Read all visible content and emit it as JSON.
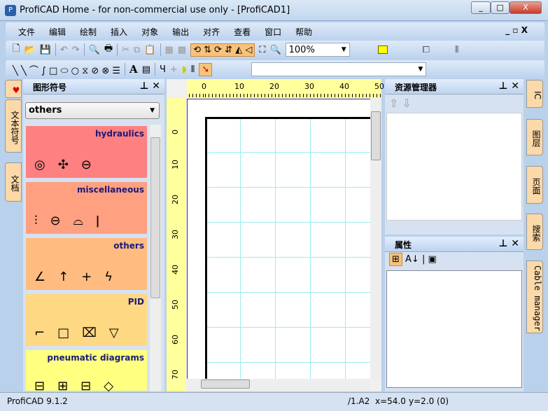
{
  "window": {
    "title": "ProfiCAD Home - for non-commercial use only - [ProfiCAD1]",
    "minimize": "_",
    "maximize": "□",
    "close": "X"
  },
  "menu": [
    "文件",
    "编辑",
    "绘制",
    "插入",
    "对象",
    "输出",
    "对齐",
    "查看",
    "窗口",
    "帮助"
  ],
  "toolbar": {
    "zoom_value": "100%",
    "text_tool": "A",
    "style_combo": ""
  },
  "left_tabs": [
    "文本符号",
    "文档"
  ],
  "symbols_panel": {
    "title": "图形符号",
    "category_select": "others",
    "categories": [
      {
        "name": "hydraulics",
        "color": "#ff8080",
        "symbols": "◎✣⊖"
      },
      {
        "name": "miscellaneous",
        "color": "#ffa080",
        "symbols": "⫶⊖⌓ǀ"
      },
      {
        "name": "others",
        "color": "#ffbb80",
        "symbols": "∠↑+ϟ"
      },
      {
        "name": "PID",
        "color": "#ffd883",
        "symbols": "⌐□⌧▽"
      },
      {
        "name": "pneumatic diagrams",
        "color": "#ffff80",
        "symbols": "⊟⊞⊟◇"
      }
    ]
  },
  "ruler": {
    "top": [
      "0",
      "10",
      "20",
      "30",
      "40",
      "50"
    ],
    "left": [
      "0",
      "10",
      "20",
      "30",
      "40",
      "50",
      "60",
      "70"
    ]
  },
  "explorer_panel": {
    "title": "资源管理器"
  },
  "properties_panel": {
    "title": "属性"
  },
  "right_tabs": [
    "IC",
    "图层",
    "页面",
    "搜索",
    "Cable manager"
  ],
  "status": {
    "version": "ProfiCAD 9.1.2",
    "sheet": "/1.A2",
    "x": "x=54.0",
    "y": "y=2.0 (0)"
  }
}
